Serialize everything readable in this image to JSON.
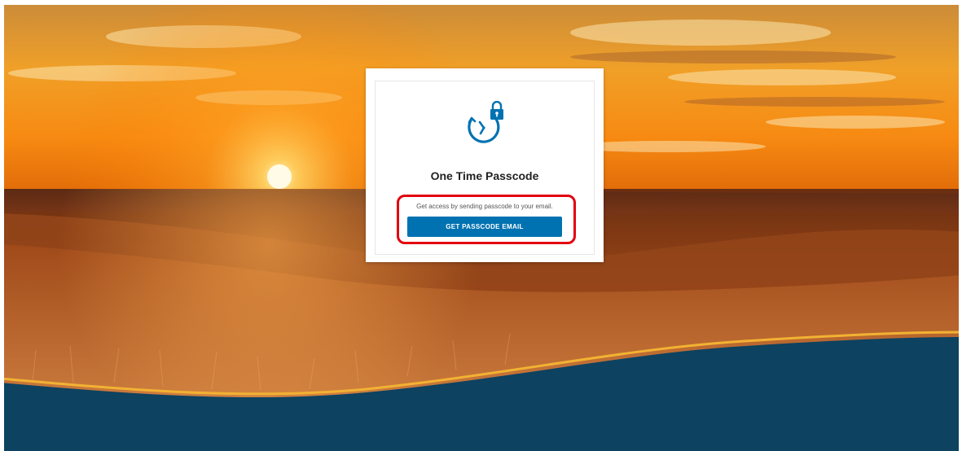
{
  "card": {
    "title": "One Time Passcode",
    "icon": "clock-lock-icon",
    "description": "Get access by sending passcode to your email.",
    "button_label": "GET PASSCODE EMAIL"
  },
  "colors": {
    "button": "#0072b1",
    "icon": "#0072b1",
    "highlight": "#e3000f",
    "footer": "#0d4260",
    "footer_accent": "#f2b233"
  }
}
